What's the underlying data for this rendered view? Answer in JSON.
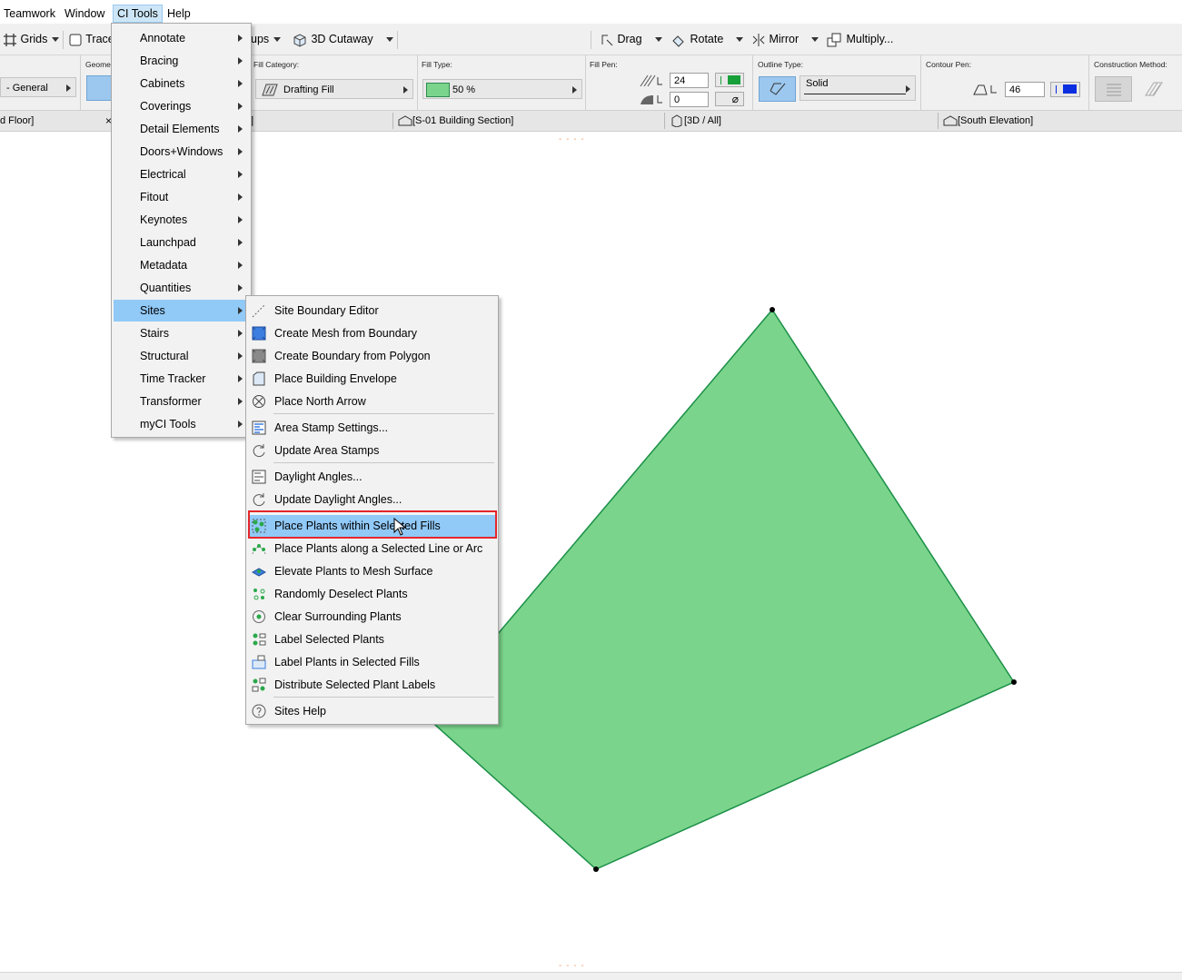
{
  "menubar": {
    "items": [
      "Teamwork",
      "Window",
      "CI Tools",
      "Help"
    ]
  },
  "toolbar": {
    "grids": "Grids",
    "trace": "Trace",
    "ups": "ups",
    "cutaway": "3D Cutaway",
    "drag": "Drag",
    "rotate": "Rotate",
    "mirror": "Mirror",
    "multiply": "Multiply..."
  },
  "infobox": {
    "geometry_label": "Geome",
    "layer_value": "- General",
    "fill_category_label": "Fill Category:",
    "fill_category_value": "Drafting Fill",
    "fill_type_label": "Fill Type:",
    "fill_type_value": "50 %",
    "fill_pen_label": "Fill Pen:",
    "fill_pen_value": "24",
    "bg_pen_value": "0",
    "outline_type_label": "Outline Type:",
    "outline_type_value": "Solid",
    "contour_pen_label": "Contour Pen:",
    "contour_pen_value": "46",
    "construction_method_label": "Construction Method:"
  },
  "tabs": {
    "floor": "d Floor]",
    "close": "×",
    "partial": "]",
    "section": "[S-01 Building Section]",
    "threed": "[3D / All]",
    "elevation": "[South Elevation]"
  },
  "ci_menu": {
    "items": [
      {
        "label": "Annotate"
      },
      {
        "label": "Bracing"
      },
      {
        "label": "Cabinets"
      },
      {
        "label": "Coverings"
      },
      {
        "label": "Detail Elements"
      },
      {
        "label": "Doors+Windows"
      },
      {
        "label": "Electrical"
      },
      {
        "label": "Fitout"
      },
      {
        "label": "Keynotes"
      },
      {
        "label": "Launchpad"
      },
      {
        "label": "Metadata"
      },
      {
        "label": "Quantities"
      },
      {
        "label": "Sites"
      },
      {
        "label": "Stairs"
      },
      {
        "label": "Structural"
      },
      {
        "label": "Time Tracker"
      },
      {
        "label": "Transformer"
      },
      {
        "label": "myCI Tools"
      }
    ]
  },
  "sites_menu": {
    "items": [
      {
        "label": "Site Boundary Editor",
        "icon": "pencil-line-icon"
      },
      {
        "label": "Create Mesh from Boundary",
        "icon": "mesh-icon"
      },
      {
        "label": "Create Boundary from Polygon",
        "icon": "polygon-boundary-icon"
      },
      {
        "label": "Place Building Envelope",
        "icon": "building-envelope-icon"
      },
      {
        "label": "Place North Arrow",
        "icon": "north-arrow-icon"
      },
      {
        "label": "Area Stamp Settings...",
        "icon": "area-stamp-icon"
      },
      {
        "label": "Update Area Stamps",
        "icon": "refresh-icon"
      },
      {
        "label": "Daylight Angles...",
        "icon": "daylight-angles-icon"
      },
      {
        "label": "Update Daylight Angles...",
        "icon": "refresh-icon"
      },
      {
        "label": "Place Plants within Selected Fills",
        "icon": "plants-fill-icon"
      },
      {
        "label": "Place Plants along a Selected Line or Arc",
        "icon": "plants-arc-icon"
      },
      {
        "label": "Elevate Plants to Mesh Surface",
        "icon": "elevate-plants-icon"
      },
      {
        "label": "Randomly Deselect Plants",
        "icon": "random-plants-icon"
      },
      {
        "label": "Clear Surrounding Plants",
        "icon": "clear-plants-icon"
      },
      {
        "label": "Label Selected Plants",
        "icon": "label-plants-icon"
      },
      {
        "label": "Label Plants in Selected Fills",
        "icon": "label-fills-icon"
      },
      {
        "label": "Distribute Selected Plant Labels",
        "icon": "distribute-labels-icon"
      },
      {
        "label": "Sites Help",
        "icon": "help-icon"
      }
    ]
  },
  "canvas": {
    "fill_color": "#7ad48b",
    "outline_color": "#1a8f47"
  },
  "colors": {
    "menu_highlight": "#91c9f7",
    "callout_border": "#e3262a"
  }
}
